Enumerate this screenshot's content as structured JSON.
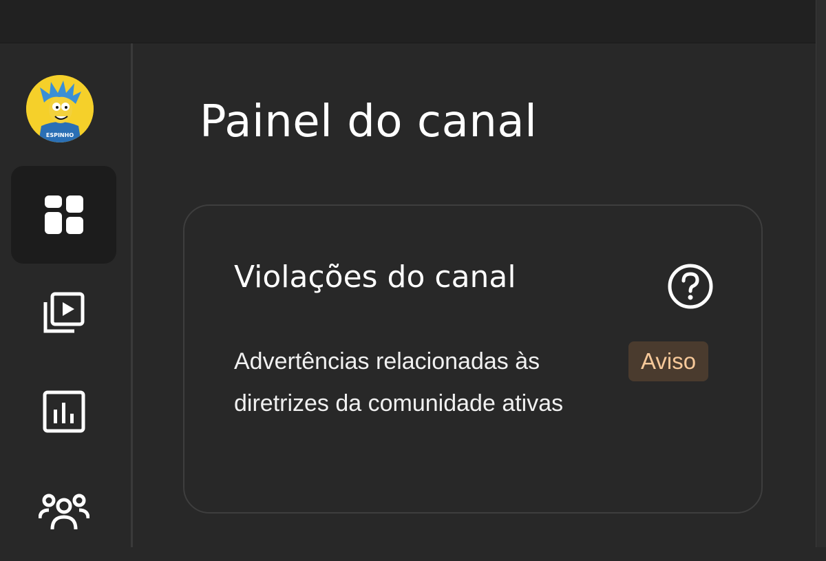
{
  "page": {
    "title": "Painel do canal"
  },
  "sidebar": {
    "avatar_text": "ESPINHO",
    "items": [
      {
        "icon": "dashboard-icon",
        "active": true
      },
      {
        "icon": "content-icon",
        "active": false
      },
      {
        "icon": "analytics-icon",
        "active": false
      },
      {
        "icon": "community-icon",
        "active": false
      }
    ]
  },
  "card": {
    "title": "Violações do canal",
    "help_icon": "help-icon",
    "description": "Advertências relacionadas às diretrizes da comunidade ativas",
    "badge_label": "Aviso"
  },
  "colors": {
    "background": "#282828",
    "topbar": "#212121",
    "active_nav": "#1c1c1c",
    "badge_bg": "#4a3b2e",
    "badge_text": "#f7c99a"
  }
}
